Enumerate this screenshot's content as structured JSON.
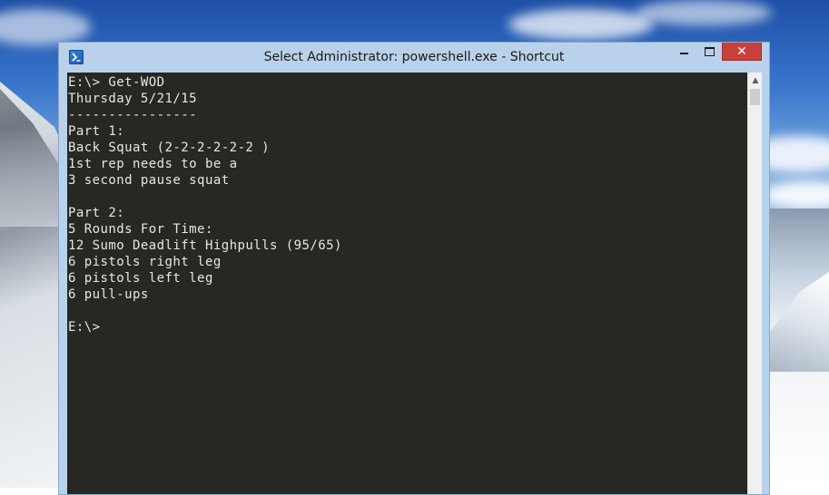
{
  "window": {
    "title": "Select Administrator: powershell.exe - Shortcut",
    "minimize_symbol": "",
    "maximize_symbol": "",
    "close_symbol": "✕",
    "icon": "powershell-icon"
  },
  "console": {
    "background_color": "#272822",
    "text_color": "#e6e6e6",
    "lines": [
      "E:\\> Get-WOD",
      "Thursday 5/21/15",
      "----------------",
      "Part 1:",
      "Back Squat (2-2-2-2-2-2 )",
      "1st rep needs to be a",
      "3 second pause squat",
      "",
      "Part 2:",
      "5 Rounds For Time:",
      "12 Sumo Deadlift Highpulls (95/65)",
      "6 pistols right leg",
      "6 pistols left leg",
      "6 pull-ups",
      "",
      "E:\\>"
    ]
  },
  "scrollbar": {
    "up_arrow_icon": "chevron-up-icon",
    "up_symbol": "▲"
  },
  "colors": {
    "titlebar": "#b9d1ea",
    "close_button": "#c7403a"
  }
}
